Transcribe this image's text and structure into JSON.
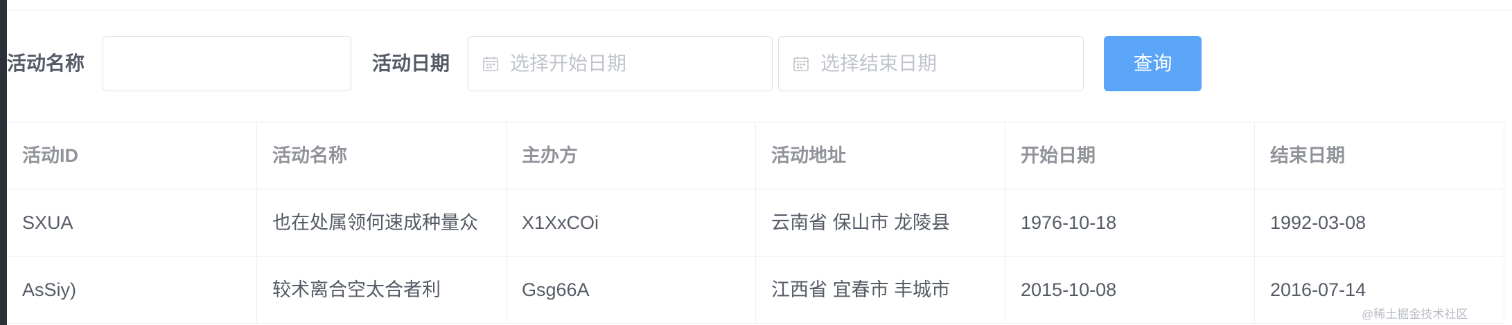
{
  "filters": {
    "name_label": "活动名称",
    "name_value": "",
    "date_label": "活动日期",
    "start_placeholder": "选择开始日期",
    "end_placeholder": "选择结束日期",
    "query_label": "查询",
    "calendar_icon": "calendar-icon"
  },
  "table": {
    "columns": [
      "活动ID",
      "活动名称",
      "主办方",
      "活动地址",
      "开始日期",
      "结束日期"
    ],
    "rows": [
      [
        "SXUA",
        "也在处属领何速成种量众",
        "X1XxCOi",
        "云南省 保山市 龙陵县",
        "1976-10-18",
        "1992-03-08"
      ],
      [
        "AsSiy)",
        "较术离合空太合者利",
        "Gsg66A",
        "江西省 宜春市 丰城市",
        "2015-10-08",
        "2016-07-14"
      ]
    ]
  },
  "watermark": "@稀土掘金技术社区",
  "colors": {
    "primary_button": "#5aa5f8",
    "border": "#dcdfe6",
    "placeholder": "#c0c4cc",
    "header_text": "#909399",
    "body_text": "#555b66",
    "left_edge": "#2b303b"
  }
}
